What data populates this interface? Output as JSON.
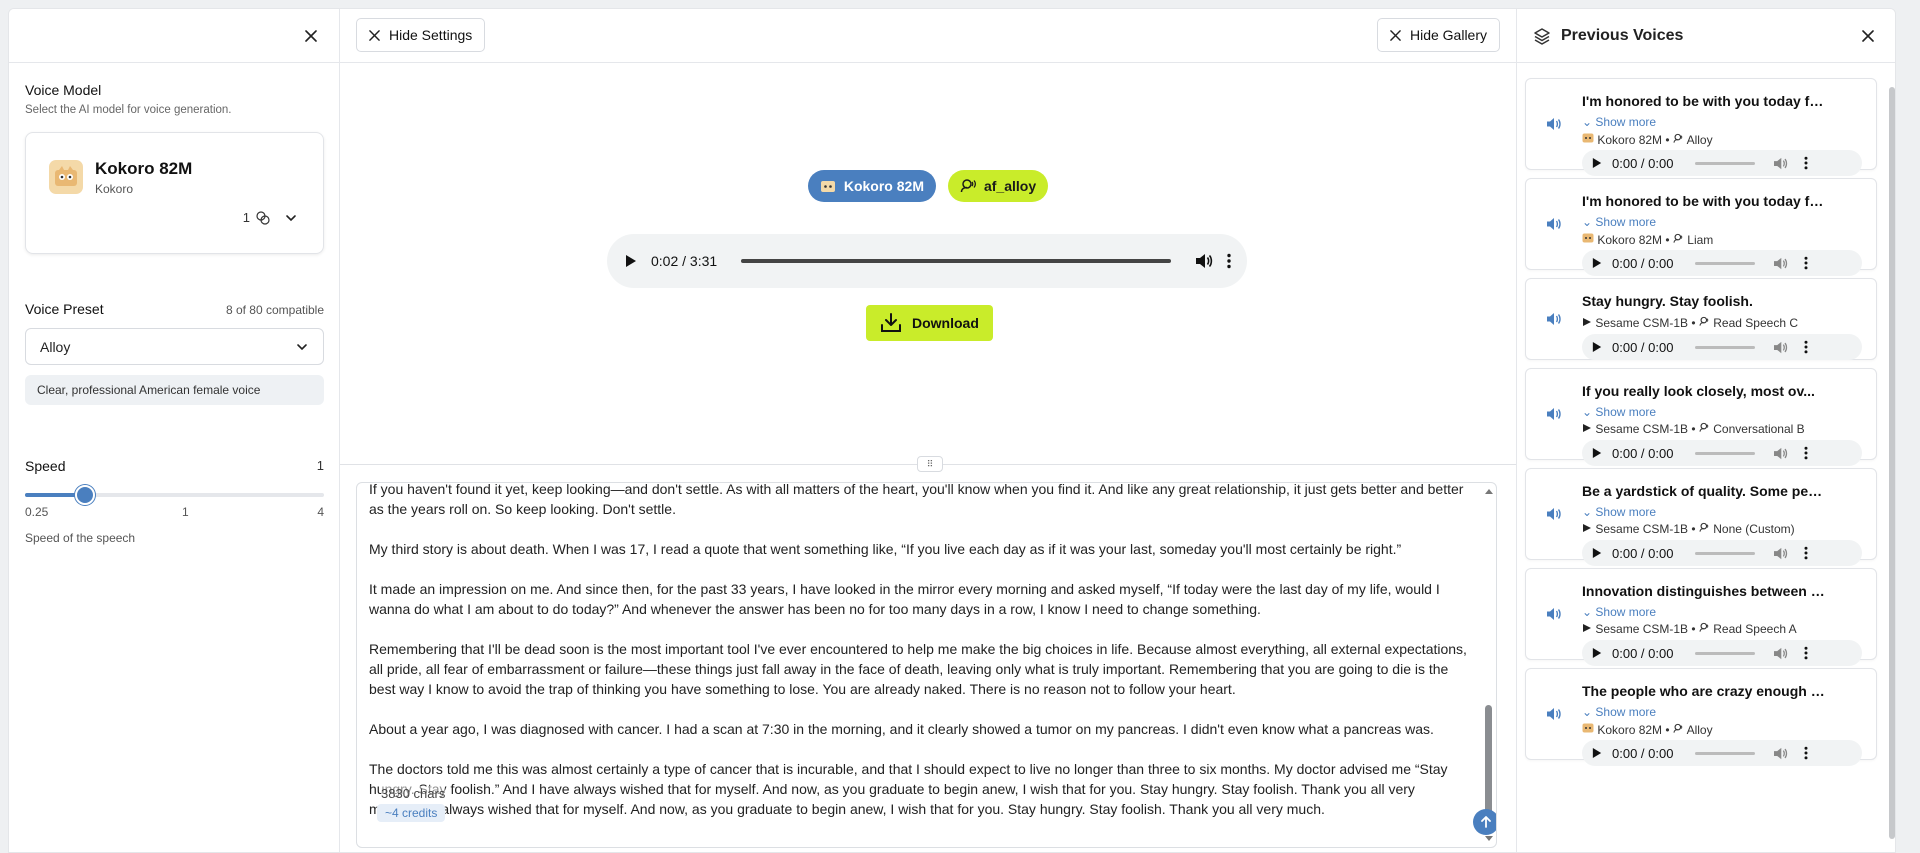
{
  "left": {
    "voice_model_title": "Voice Model",
    "voice_model_sub": "Select the AI model for voice generation.",
    "model_name": "Kokoro 82M",
    "model_provider": "Kokoro",
    "model_count": "1",
    "preset_title": "Voice Preset",
    "preset_count": "8 of 80 compatible",
    "preset_value": "Alloy",
    "preset_desc": "Clear, professional American female voice",
    "speed_title": "Speed",
    "speed_value": "1",
    "speed_min": "0.25",
    "speed_mid": "1",
    "speed_max": "4",
    "speed_level": 0.2,
    "speed_sub": "Speed of the speech"
  },
  "center": {
    "hide_settings": "Hide Settings",
    "hide_gallery": "Hide Gallery",
    "tag_model": "Kokoro 82M",
    "tag_voice": "af_alloy",
    "player_time": "0:02 / 3:31",
    "download": "Download",
    "paragraphs": [
      "If you haven't found it yet, keep looking—and don't settle. As with all matters of the heart, you'll know when you find it. And like any great relationship, it just gets better and better as the years roll on. So keep looking. Don't settle.",
      "My third story is about death. When I was 17, I read a quote that went something like, “If you live each day as if it was your last, someday you'll most certainly be right.”",
      "It made an impression on me. And since then, for the past 33 years, I have looked in the mirror every morning and asked myself, “If today were the last day of my life, would I wanna do what I am about to do today?” And whenever the answer has been no for too many days in a row, I know I need to change something.",
      "Remembering that I'll be dead soon is the most important tool I've ever encountered to help me make the big choices in life. Because almost everything, all external expectations, all pride, all fear of embarrassment or failure—these things just fall away in the face of death, leaving only what is truly important. Remembering that you are going to die is the best way I know to avoid the trap of thinking you have something to lose. You are already naked. There is no reason not to follow your heart.",
      "About a year ago, I was diagnosed with cancer. I had a scan at 7:30 in the morning, and it clearly showed a tumor on my pancreas. I didn't even know what a pancreas was.",
      "The doctors told me this was almost certainly a type of cancer that is incurable, and that I should expect to live no longer than three to six months. My doctor advised me “Stay hungry. Stay foolish.” And I have always wished that for myself. And now, as you graduate to begin anew, I wish that for you. Stay hungry. Stay foolish. Thank you all very much.have always wished that for myself. And now, as you graduate to begin anew, I wish that for you. Stay hungry. Stay foolish. Thank you all very much."
    ],
    "overlay_chars": "3830 chars",
    "credits": "~4 credits"
  },
  "right": {
    "title": "Previous Voices",
    "show_more": "Show more",
    "cards": [
      {
        "title": "I'm honored to be with you today fo...",
        "more": true,
        "model": "Kokoro 82M",
        "voice": "Alloy",
        "time": "0:00 / 0:00",
        "model_icon": "kokoro"
      },
      {
        "title": "I'm honored to be with you today fo...",
        "more": true,
        "model": "Kokoro 82M",
        "voice": "Liam",
        "time": "0:00 / 0:00",
        "model_icon": "kokoro"
      },
      {
        "title": "Stay hungry. Stay foolish.",
        "more": false,
        "model": "Sesame CSM-1B",
        "voice": "Read Speech C",
        "time": "0:00 / 0:00",
        "model_icon": "sesame"
      },
      {
        "title": "If you really look closely, most ov...",
        "more": true,
        "model": "Sesame CSM-1B",
        "voice": "Conversational B",
        "time": "0:00 / 0:00",
        "model_icon": "sesame"
      },
      {
        "title": "Be a yardstick of quality. Some peo...",
        "more": true,
        "model": "Sesame CSM-1B",
        "voice": "None (Custom)",
        "time": "0:00 / 0:00",
        "model_icon": "sesame"
      },
      {
        "title": "Innovation distinguishes between a ...",
        "more": true,
        "model": "Sesame CSM-1B",
        "voice": "Read Speech A",
        "time": "0:00 / 0:00",
        "model_icon": "sesame"
      },
      {
        "title": "The people who are crazy enough t...",
        "more": true,
        "model": "Kokoro 82M",
        "voice": "Alloy",
        "time": "0:00 / 0:00",
        "model_icon": "kokoro"
      }
    ]
  },
  "colors": {
    "accent": "#4a7fbf",
    "lime": "#c9ec2a"
  }
}
